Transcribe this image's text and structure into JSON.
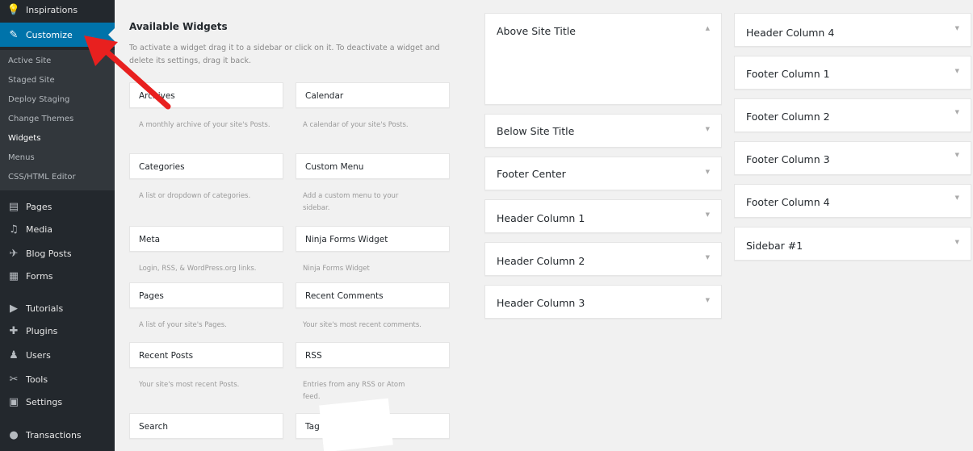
{
  "sidebar": {
    "items": [
      {
        "label": "Inspirations",
        "icon": "lightbulb-icon",
        "glyph": "💡"
      },
      {
        "label": "Customize",
        "icon": "brush-icon",
        "glyph": "✎"
      },
      {
        "label": "Pages",
        "icon": "pages-icon",
        "glyph": "▤"
      },
      {
        "label": "Media",
        "icon": "media-icon",
        "glyph": "♫"
      },
      {
        "label": "Blog Posts",
        "icon": "pin-icon",
        "glyph": "✈"
      },
      {
        "label": "Forms",
        "icon": "forms-icon",
        "glyph": "▦"
      },
      {
        "label": "Tutorials",
        "icon": "tutorials-icon",
        "glyph": "▶"
      },
      {
        "label": "Plugins",
        "icon": "plugin-icon",
        "glyph": "✚"
      },
      {
        "label": "Users",
        "icon": "users-icon",
        "glyph": "♟"
      },
      {
        "label": "Tools",
        "icon": "wrench-icon",
        "glyph": "✂"
      },
      {
        "label": "Settings",
        "icon": "settings-icon",
        "glyph": "▣"
      },
      {
        "label": "Transactions",
        "icon": "transactions-icon",
        "glyph": "●"
      }
    ],
    "submenu": [
      "Active Site",
      "Staged Site",
      "Deploy Staging",
      "Change Themes",
      "Widgets",
      "Menus",
      "CSS/HTML Editor"
    ]
  },
  "available": {
    "title": "Available Widgets",
    "description": "To activate a widget drag it to a sidebar or click on it. To deactivate a widget and delete its settings, drag it back.",
    "widgets": [
      {
        "label": "Archives",
        "desc": "A monthly archive of your site's Posts."
      },
      {
        "label": "Calendar",
        "desc": "A calendar of your site's Posts."
      },
      {
        "label": "Categories",
        "desc": "A list or dropdown of categories."
      },
      {
        "label": "Custom Menu",
        "desc": "Add a custom menu to your sidebar."
      },
      {
        "label": "Meta",
        "desc": "Login, RSS, & WordPress.org links."
      },
      {
        "label": "Ninja Forms Widget",
        "desc": "Ninja Forms Widget"
      },
      {
        "label": "Pages",
        "desc": "A list of your site's Pages."
      },
      {
        "label": "Recent Comments",
        "desc": "Your site's most recent comments."
      },
      {
        "label": "Recent Posts",
        "desc": "Your site's most recent Posts."
      },
      {
        "label": "RSS",
        "desc": "Entries from any RSS or Atom feed."
      },
      {
        "label": "Search",
        "desc": ""
      },
      {
        "label": "Tag",
        "desc": ""
      }
    ]
  },
  "sidebars_col1": [
    "Above Site Title",
    "Below Site Title",
    "Footer Center",
    "Header Column 1",
    "Header Column 2",
    "Header Column 3"
  ],
  "sidebars_col2": [
    "Header Column 4",
    "Footer Column 1",
    "Footer Column 2",
    "Footer Column 3",
    "Footer Column 4",
    "Sidebar #1"
  ],
  "colors": {
    "sidebar_bg": "#23282d",
    "active": "#0073aa",
    "arrow": "#e8201f"
  }
}
